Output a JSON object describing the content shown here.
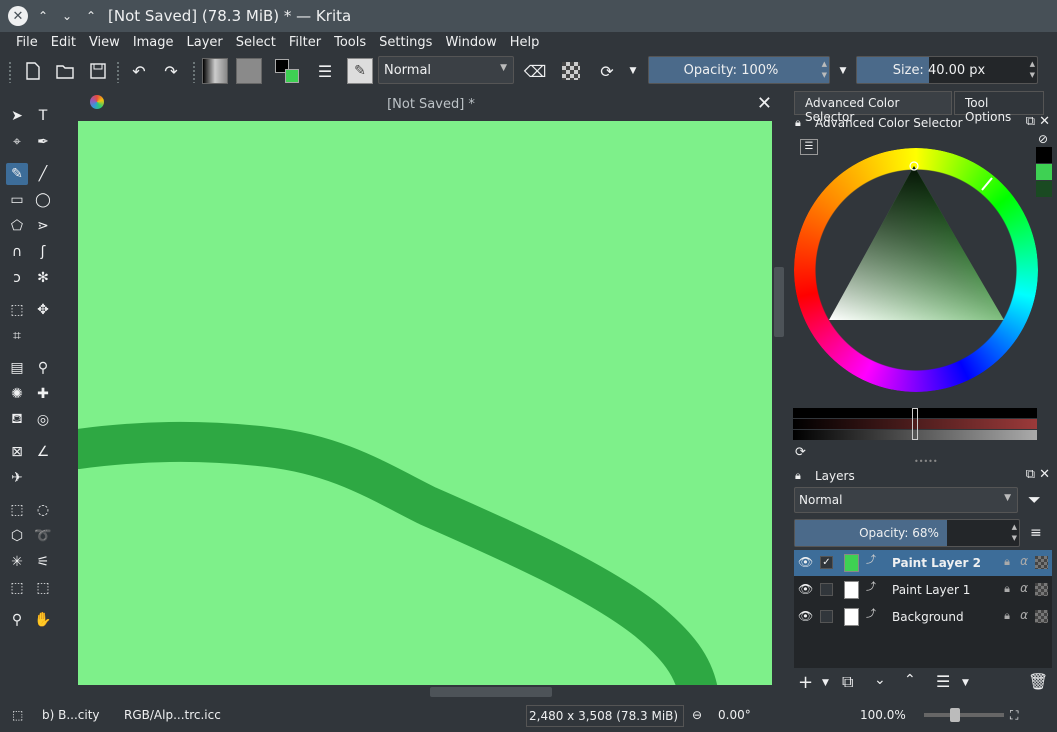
{
  "window": {
    "title": "[Not Saved] (78.3 MiB) * — Krita"
  },
  "menu": [
    "File",
    "Edit",
    "View",
    "Image",
    "Layer",
    "Select",
    "Filter",
    "Tools",
    "Settings",
    "Window",
    "Help"
  ],
  "toolbar": {
    "blend_mode": "Normal",
    "opacity_label": "Opacity: 100%",
    "opacity_value": 1.0,
    "size_label": "Size: 40.00 px",
    "size_value": 0.4
  },
  "document": {
    "tab_title": "[Not Saved]  *",
    "canvas_color": "#7ef08a",
    "stroke_color": "#2ea843"
  },
  "dock_tabs": [
    "Advanced Color Selector",
    "Tool Options"
  ],
  "color_selector": {
    "title": "Advanced Color Selector",
    "history": [
      "#000000",
      "#3ed153",
      "#1a4a22"
    ]
  },
  "layers_panel": {
    "title": "Layers",
    "blend_mode": "Normal",
    "opacity_label": "Opacity:  68%",
    "opacity_value": 0.68,
    "layers": [
      {
        "name": "Paint Layer 2",
        "selected": true,
        "checked": "✓",
        "thumb": "#3ed153"
      },
      {
        "name": "Paint Layer 1",
        "selected": false,
        "checked": "",
        "thumb": "#ffffff"
      },
      {
        "name": "Background",
        "selected": false,
        "checked": "",
        "thumb": "#ffffff"
      }
    ]
  },
  "statusbar": {
    "brush": "b) B...city",
    "color_profile": "RGB/Alp...trc.icc",
    "dimensions": "2,480 x 3,508 (78.3 MiB)",
    "rotation": "0.00°",
    "zoom": "100.0%"
  }
}
